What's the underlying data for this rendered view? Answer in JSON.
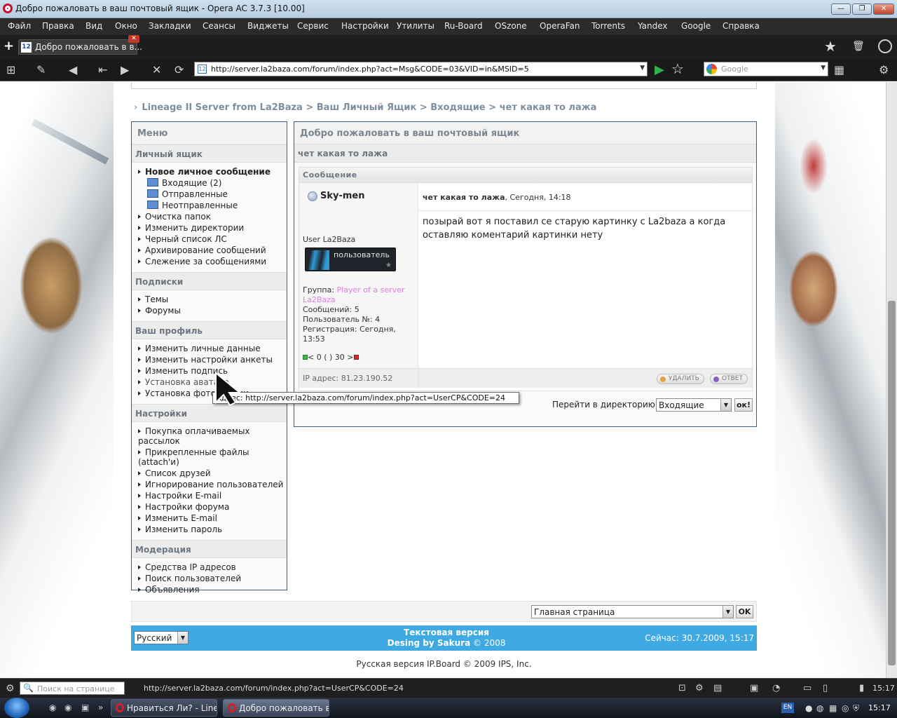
{
  "window": {
    "title": "Добро пожаловать в ваш почтовый ящик - Opera AC 3.7.3 [10.00]",
    "min": "—",
    "max": "❐",
    "close": "✕"
  },
  "menubar": [
    "Файл",
    "Правка",
    "Вид",
    "Окно",
    "Закладки",
    "Сеансы",
    "Виджеты",
    "Сервис",
    "Настройки",
    "Утилиты",
    "Ru-Board",
    "OSzone",
    "OperaFan",
    "Torrents",
    "Yandex",
    "Google",
    "Справка"
  ],
  "tab": {
    "title": "Добро пожаловать в в...",
    "favicon": "12",
    "close": "✕"
  },
  "addressbar": {
    "url": "http://server.la2baza.com/forum/index.php?act=Msg&CODE=03&VID=in&MSID=5",
    "favicon": "12"
  },
  "searchbar": {
    "placeholder": "Google"
  },
  "breadcrumb": {
    "arrow": "›",
    "items": [
      "Lineage II Server from La2Baza",
      "Ваш Личный Ящик",
      "Входящие",
      "чет какая то лажа"
    ],
    "sep": " > "
  },
  "menu": {
    "title": "Меню",
    "sections": [
      {
        "title": "Личный ящик"
      },
      {
        "title": "Подписки"
      },
      {
        "title": "Ваш профиль"
      },
      {
        "title": "Настройки"
      },
      {
        "title": "Модерация"
      }
    ],
    "mailbox": {
      "new": "Новое личное сообщение",
      "inbox": "Входящие (2)",
      "sent": "Отправленные",
      "unsent": "Неотправленные",
      "clear": "Очистка папок",
      "dirs": "Изменить директории",
      "blacklist": "Черный список ЛС",
      "archive": "Архивирование сообщений",
      "tracking": "Слежение за сообщениями"
    },
    "subs": {
      "topics": "Темы",
      "forums": "Форумы"
    },
    "profile": {
      "personal": "Изменить личные данные",
      "settings": "Изменить настройки анкеты",
      "signature": "Изменить подпись",
      "avatar": "Установка аватара",
      "photo": "Установка фотографии"
    },
    "settings": {
      "paid": "Покупка оплачиваемых рассылок",
      "attach": "Прикрепленные файлы (attach'и)",
      "friends": "Список друзей",
      "ignore": "Игнорирование пользователей",
      "email_settings": "Настройки E-mail",
      "forum_settings": "Настройки форума",
      "email": "Изменить E-mail",
      "password": "Изменить пароль"
    },
    "moderation": {
      "ip": "Средства IP адресов",
      "users": "Поиск пользователей",
      "ads": "Объявления"
    }
  },
  "main": {
    "title": "Добро пожаловать в ваш почтовый ящик",
    "subject": "чет какая то лажа",
    "section": "Сообщение",
    "author": "Sky-men",
    "post_title": "чет какая то лажа",
    "post_date": ", Сегодня, 14:18",
    "body": "позырай вот я поставил се старую картинку с La2baza  а когда оставляю коментарий картинки нету",
    "user_title": "User La2Baza",
    "badge_label": "пользователь",
    "badge_star": "★",
    "group_label": "Группа: ",
    "group_value": "Player of a server La2Baza",
    "posts": "Сообщений: 5",
    "member_no": "Пользователь №: 4",
    "reg": "Регистрация: Сегодня, 13:53",
    "rep_left": "< 0 ( ) 30 >",
    "ip": "IP адрес: 81.23.190.52",
    "delete": "УДАЛИТЬ",
    "reply": "ОТВЕТ",
    "dir_label": "Перейти в директорию:",
    "dir_value": "Входящие",
    "dir_ok": "ок!"
  },
  "tooltip": "Адрес: http://server.la2baza.com/forum/index.php?act=UserCP&CODE=24",
  "footer": {
    "jump_value": "Главная страница",
    "jump_ok": "OK",
    "lang": "Русский",
    "text_version": "Текстовая версия",
    "design": "Desing by Sakura",
    "design_year": " © 2008",
    "now": "Сейчас: 30.7.2009, 15:17",
    "copyright": "Русская версия IP.Board © 2009  IPS, Inc."
  },
  "statusbar": {
    "find_placeholder": "Поиск на странице",
    "url": "http://server.la2baza.com/forum/index.php?act=UserCP&CODE=24",
    "time": "15:17"
  },
  "taskbar": {
    "tasks": [
      "Нравиться Ли? - Line...",
      "Добро пожаловать в..."
    ],
    "lang": "EN",
    "clock": "15:17"
  },
  "colors": {
    "accent": "#3fa9e3",
    "border": "#3a5e8c",
    "group": "#e07ce6"
  }
}
